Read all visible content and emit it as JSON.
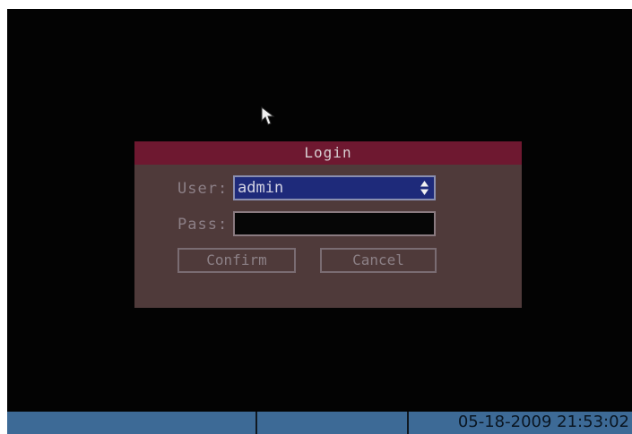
{
  "dialog": {
    "title": "Login",
    "user_label": "User:",
    "user_value": "admin",
    "pass_label": "Pass:",
    "pass_value": "",
    "confirm_label": "Confirm",
    "cancel_label": "Cancel"
  },
  "statusbar": {
    "datetime": "05-18-2009 21:53:02"
  },
  "colors": {
    "screen": "#030303",
    "dialog_body": "#4f3a3a",
    "dialog_title": "#6e1830",
    "user_select": "#1e2a7a",
    "taskbar": "#3d6a96"
  },
  "icons": {
    "cursor": "mouse-pointer-icon",
    "spinner": "up-down-arrows-icon"
  }
}
